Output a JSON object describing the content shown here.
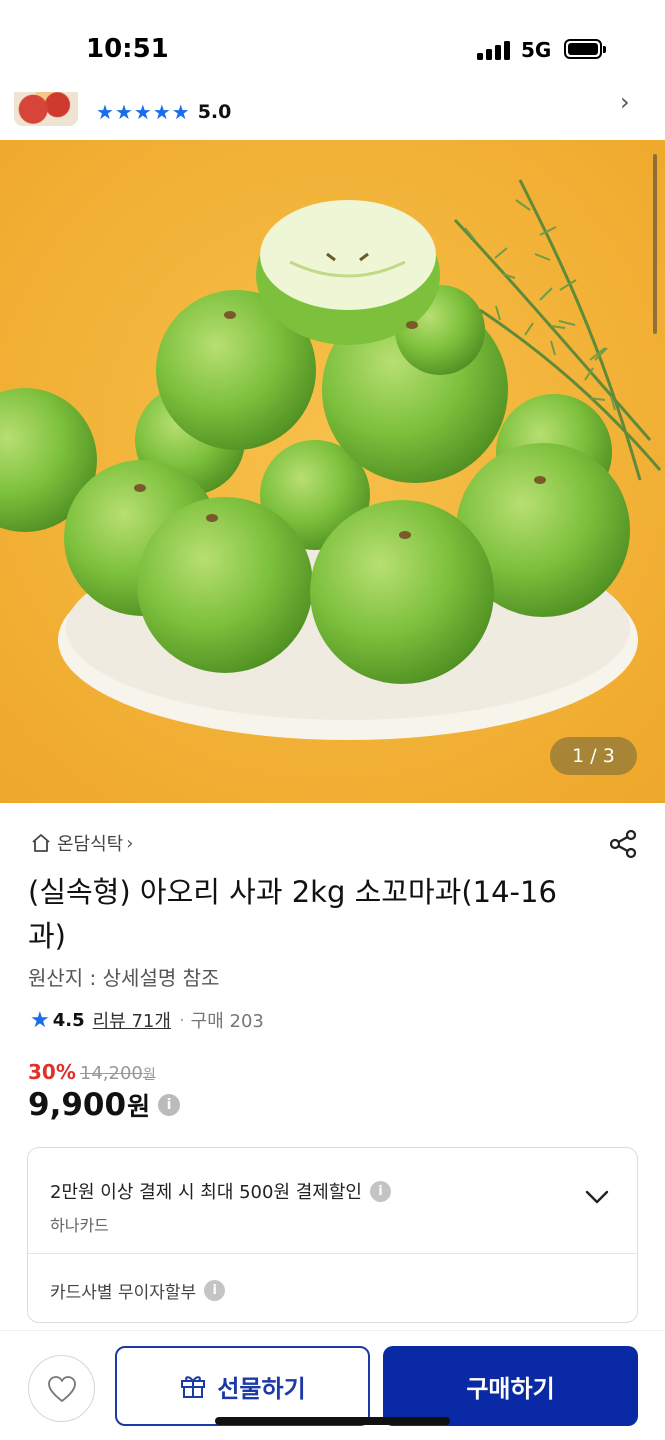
{
  "status_bar": {
    "time": "10:51",
    "network": "5G"
  },
  "mini_header": {
    "rating": "5.0"
  },
  "hero": {
    "page_counter": "1 / 3"
  },
  "product": {
    "store": "온담식탁",
    "title": "(실속형) 아오리 사과 2kg 소꼬마과(14-16과)",
    "origin": "원산지 : 상세설명 참조",
    "rating": "4.5",
    "reviews": "리뷰 71개",
    "purchases": "구매 203",
    "discount": "30%",
    "original_price": "14,200",
    "original_price_unit": "원",
    "price": "9,900",
    "price_unit": "원"
  },
  "benefits": {
    "card_discount": "2만원 이상 결제 시 최대 500원 결제할인",
    "card_name": "하나카드",
    "installment": "카드사별 무이자할부"
  },
  "actions": {
    "gift_label": "선물하기",
    "buy_label": "구매하기"
  },
  "colors": {
    "accent_blue": "#0a2aa5",
    "star_blue": "#1a6ee8",
    "discount_red": "#e0312a"
  },
  "icons": [
    "home-icon",
    "share-icon",
    "info-icon",
    "chevron-down-icon",
    "heart-icon",
    "gift-icon",
    "star-icon"
  ]
}
